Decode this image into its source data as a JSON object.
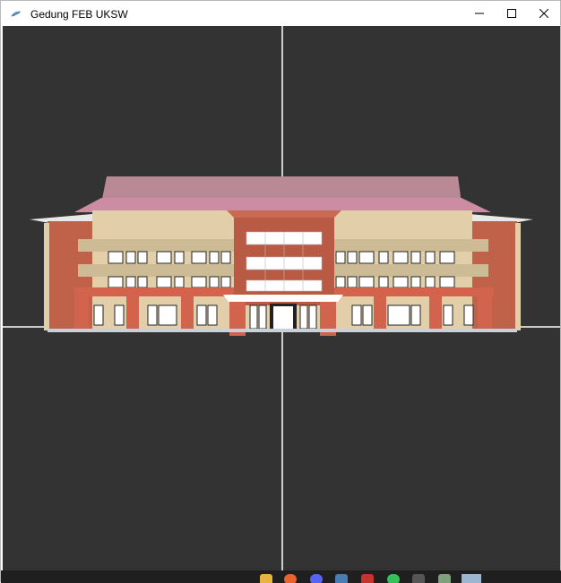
{
  "window": {
    "title": "Gedung FEB UKSW",
    "icon": "app-feather-icon",
    "buttons": [
      {
        "name": "minimize-button",
        "icon": "minimize-icon",
        "glyph": "—"
      },
      {
        "name": "maximize-button",
        "icon": "maximize-icon",
        "glyph": "☐"
      },
      {
        "name": "close-button",
        "icon": "close-icon",
        "glyph": "✕"
      }
    ]
  },
  "scene": {
    "background_color": "#333333",
    "axis_color": "#ffffff",
    "roof_color": "#c88aa0",
    "wall_cream": "#e3ceaa",
    "wall_red": "#c0624a",
    "band_tan": "#cdbb96",
    "window_color": "#ffffff",
    "mullion_color": "#222222"
  },
  "taskbar": {
    "background": "#1f1f1f",
    "icons": [
      {
        "name": "file-explorer-icon",
        "color": "#e8b53c"
      },
      {
        "name": "firefox-icon",
        "color": "#e8632e"
      },
      {
        "name": "discord-icon",
        "color": "#5865f2"
      },
      {
        "name": "steam-icon",
        "color": "#4a7cb4"
      },
      {
        "name": "game-launcher-icon",
        "color": "#c7332d"
      },
      {
        "name": "whatsapp-icon",
        "color": "#34c15a"
      },
      {
        "name": "terminal-icon",
        "color": "#555555"
      },
      {
        "name": "app-window-icon",
        "color": "#7fa17c"
      },
      {
        "name": "opengl-app-icon",
        "color": "#9cb6cf"
      }
    ]
  }
}
